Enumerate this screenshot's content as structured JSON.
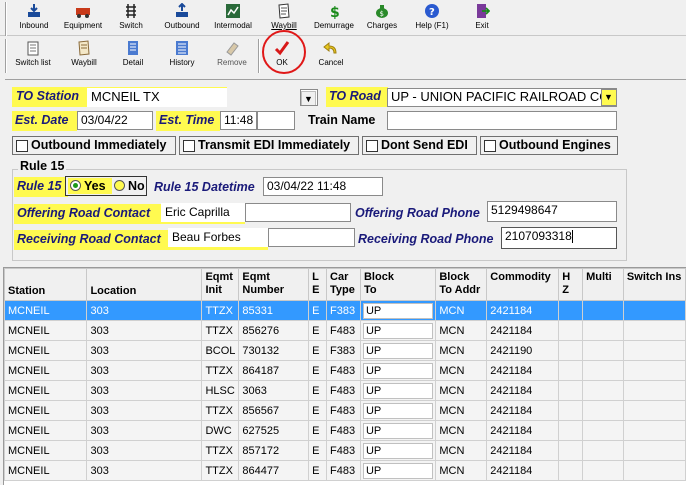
{
  "toolbar1": [
    {
      "label": "Inbound",
      "icon": "inbound-icon"
    },
    {
      "label": "Equipment",
      "icon": "equipment-icon"
    },
    {
      "label": "Switch",
      "icon": "switch-icon"
    },
    {
      "label": "Outbound",
      "icon": "outbound-icon"
    },
    {
      "label": "Intermodal",
      "icon": "intermodal-icon"
    },
    {
      "label": "Waybill",
      "icon": "waybill-icon"
    },
    {
      "label": "Demurrage",
      "icon": "dollar-icon"
    },
    {
      "label": "Charges",
      "icon": "moneybag-icon"
    },
    {
      "label": "Help (F1)",
      "icon": "help-icon"
    },
    {
      "label": "Exit",
      "icon": "exit-icon"
    }
  ],
  "toolbar2": [
    {
      "label": "Switch list",
      "icon": "switch-list-icon"
    },
    {
      "label": "Waybill",
      "icon": "waybill-icon"
    },
    {
      "label": "Detail",
      "icon": "detail-icon"
    },
    {
      "label": "History",
      "icon": "history-icon"
    },
    {
      "label": "Remove",
      "icon": "eraser-icon"
    },
    {
      "label": "OK",
      "icon": "checkmark-icon"
    },
    {
      "label": "Cancel",
      "icon": "undo-arrow-icon"
    }
  ],
  "form": {
    "to_station_label": "TO Station",
    "to_station_value": "MCNEIL TX",
    "to_road_label": "TO Road",
    "to_road_value": "UP - UNION PACIFIC RAILROAD CO",
    "est_date_label": "Est. Date",
    "est_date_value": "03/04/22",
    "est_time_label": "Est. Time",
    "est_time_value": "11:48",
    "train_name_label": "Train Name",
    "train_name_value": "",
    "checkboxes": [
      "Outbound Immediately",
      "Transmit EDI Immediately",
      "Dont Send EDI",
      "Outbound Engines"
    ],
    "rule15_group": "Rule 15",
    "rule15_label": "Rule 15",
    "rule15_yes": "Yes",
    "rule15_no": "No",
    "rule15_datetime_label": "Rule 15 Datetime",
    "rule15_datetime_value": "03/04/22 11:48",
    "offering_contact_label": "Offering Road Contact",
    "offering_contact_value": "Eric Caprilla",
    "offering_phone_label": "Offering Road Phone",
    "offering_phone_value": "5129498647",
    "receiving_contact_label": "Receiving Road Contact",
    "receiving_contact_value": "Beau Forbes",
    "receiving_phone_label": "Receiving Road Phone",
    "receiving_phone_value": "2107093318"
  },
  "grid": {
    "headers": [
      "Station",
      "Location",
      "Eqmt\nInit",
      "Eqmt\nNumber",
      "L\nE",
      "Car\nType",
      "Block\nTo",
      "Block\nTo Addr",
      "Commodity",
      "H\nZ",
      "Multi",
      "Switch Ins"
    ],
    "rows": [
      [
        "MCNEIL",
        "303",
        "TTZX",
        "85331",
        "E",
        "F383",
        "UP",
        "MCN",
        "2421184",
        "",
        "",
        ""
      ],
      [
        "MCNEIL",
        "303",
        "TTZX",
        "856276",
        "E",
        "F483",
        "UP",
        "MCN",
        "2421184",
        "",
        "",
        ""
      ],
      [
        "MCNEIL",
        "303",
        "BCOL",
        "730132",
        "E",
        "F383",
        "UP",
        "MCN",
        "2421190",
        "",
        "",
        ""
      ],
      [
        "MCNEIL",
        "303",
        "TTZX",
        "864187",
        "E",
        "F483",
        "UP",
        "MCN",
        "2421184",
        "",
        "",
        ""
      ],
      [
        "MCNEIL",
        "303",
        "HLSC",
        "3063",
        "E",
        "F483",
        "UP",
        "MCN",
        "2421184",
        "",
        "",
        ""
      ],
      [
        "MCNEIL",
        "303",
        "TTZX",
        "856567",
        "E",
        "F483",
        "UP",
        "MCN",
        "2421184",
        "",
        "",
        ""
      ],
      [
        "MCNEIL",
        "303",
        "DWC",
        "627525",
        "E",
        "F483",
        "UP",
        "MCN",
        "2421184",
        "",
        "",
        ""
      ],
      [
        "MCNEIL",
        "303",
        "TTZX",
        "857172",
        "E",
        "F483",
        "UP",
        "MCN",
        "2421184",
        "",
        "",
        ""
      ],
      [
        "MCNEIL",
        "303",
        "TTZX",
        "864477",
        "E",
        "F483",
        "UP",
        "MCN",
        "2421184",
        "",
        "",
        ""
      ]
    ]
  },
  "colors": {
    "highlight": "#fffa50",
    "selection": "#3399ff",
    "label_navy": "#1a1a7a",
    "annotation_red": "#e01818"
  }
}
